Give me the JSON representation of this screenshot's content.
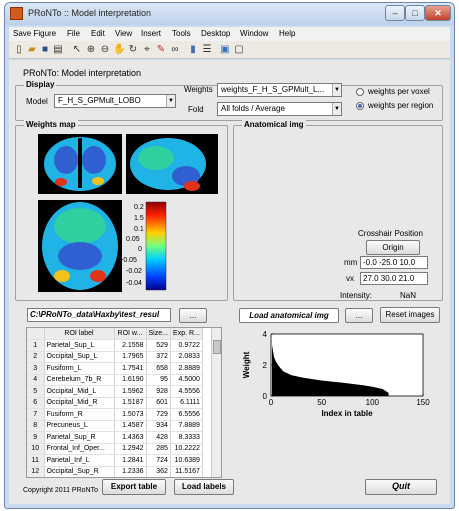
{
  "window": {
    "title": "PRoNTo :: Model interpretation",
    "min_label": "–",
    "max_label": "□",
    "close_label": "✕"
  },
  "menu": [
    "Save Figure",
    "File",
    "Edit",
    "View",
    "Insert",
    "Tools",
    "Desktop",
    "Window",
    "Help"
  ],
  "toolbar_icons": [
    "new-file-icon",
    "open-folder-icon",
    "save-icon",
    "print-icon",
    "pointer-icon",
    "zoom-in-icon",
    "zoom-out-icon",
    "pan-icon",
    "rotate-icon",
    "data-cursor-icon",
    "brush-icon",
    "link-icon",
    "colorbar-icon",
    "legend-icon",
    "hide-tools-icon",
    "show-tools-icon"
  ],
  "header": {
    "title": "PRoNTo: Model interpretation"
  },
  "display": {
    "title": "Display",
    "model_label": "Model",
    "model_value": "F_H_S_GPMult_LOBO",
    "weights_label": "Weights",
    "weights_value": "weights_F_H_S_GPMult_L...",
    "fold_label": "Fold",
    "fold_value": "All folds / Average",
    "radio_voxel": "weights per voxel",
    "radio_region": "weights per region"
  },
  "weights_map": {
    "title": "Weights map",
    "colorbar_ticks": [
      "0.2",
      "1.5",
      "0.1",
      "0.05",
      "0",
      "-0.05",
      "-0.02",
      "-0.04"
    ]
  },
  "anatomical": {
    "title": "Anatomical img",
    "crosshair_label": "Crosshair Position",
    "origin_button": "Origin",
    "mm_label": "mm",
    "mm_value": "-0.0 -25.0 10.0",
    "vx_label": "vx",
    "vx_value": "27.0 30.0 21.0",
    "intensity_label": "Intensity:",
    "intensity_value": "NaN"
  },
  "files": {
    "weights_path": "C:\\PRoNTo_data\\Haxby\\test_resul",
    "browse1": "...",
    "load_anatomical": "Load anatomical img",
    "browse2": "...",
    "reset_images": "Reset images"
  },
  "table": {
    "headers": [
      "",
      "ROI label",
      "ROI w...",
      "Size...",
      "Exp. R..."
    ],
    "rows": [
      [
        "1",
        "Parietal_Sup_L",
        "2.1558",
        "529",
        "0.9722"
      ],
      [
        "2",
        "Occipital_Sup_L",
        "1.7965",
        "372",
        "2.0833"
      ],
      [
        "3",
        "Fusiform_L",
        "1.7541",
        "658",
        "2.8889"
      ],
      [
        "4",
        "Cerebelum_7b_R",
        "1.6190",
        "95",
        "4.5000"
      ],
      [
        "5",
        "Occipital_Mid_L",
        "1.5962",
        "928",
        "4.5556"
      ],
      [
        "6",
        "Occipital_Mid_R",
        "1.5187",
        "601",
        "6.1111"
      ],
      [
        "7",
        "Fusiform_R",
        "1.5073",
        "729",
        "6.5556"
      ],
      [
        "8",
        "Precuneus_L",
        "1.4587",
        "934",
        "7.8889"
      ],
      [
        "9",
        "Parietal_Sup_R",
        "1.4363",
        "428",
        "8.3333"
      ],
      [
        "10",
        "Frontal_Inf_Oper...",
        "1.2942",
        "285",
        "10.2222"
      ],
      [
        "11",
        "Parietal_Inf_L",
        "1.2841",
        "724",
        "10.6389"
      ],
      [
        "12",
        "Occipital_Sup_R",
        "1.2336",
        "362",
        "11.5167"
      ]
    ]
  },
  "chart_data": {
    "type": "area",
    "title": "",
    "xlabel": "Index in table",
    "ylabel": "Weight",
    "xlim": [
      0,
      150
    ],
    "ylim": [
      0,
      4
    ],
    "xticks": [
      "0",
      "50",
      "100",
      "150"
    ],
    "yticks": [
      "0",
      "2",
      "4"
    ],
    "x": [
      1,
      2,
      3,
      5,
      8,
      12,
      20,
      30,
      40,
      50,
      60,
      70,
      80,
      90,
      100,
      110,
      116
    ],
    "values": [
      3.3,
      2.9,
      2.5,
      2.2,
      1.9,
      1.6,
      1.35,
      1.2,
      1.1,
      1.0,
      0.93,
      0.86,
      0.78,
      0.7,
      0.6,
      0.45,
      0.2
    ],
    "fill_color": "#000000"
  },
  "bottom": {
    "copyright": "Copyright 2011 PRoNTo",
    "export_table": "Export table",
    "load_labels": "Load labels",
    "quit": "Quit"
  }
}
